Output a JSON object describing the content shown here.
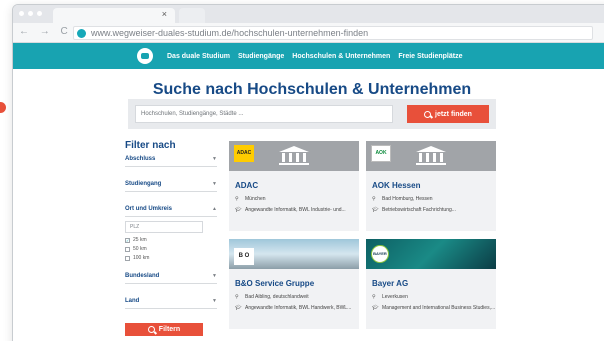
{
  "browser": {
    "url": "www.wegweiser-duales-studium.de/hochschulen-unternehmen-finden",
    "tab_close": "×",
    "nav_buttons": "← → C ⌂"
  },
  "sitenav": {
    "items": [
      "Das duale Studium",
      "Studiengänge",
      "Hochschulen & Unternehmen",
      "Freie Studienplätze"
    ]
  },
  "page": {
    "title": "Suche nach Hochschulen & Unternehmen"
  },
  "search": {
    "placeholder": "Hochschulen, Studiengänge, Städte ...",
    "button": "jetzt finden"
  },
  "filter": {
    "title": "Filter nach",
    "abschluss": "Abschluss",
    "studiengang": "Studiengang",
    "ort": "Ort und Umkreis",
    "plz_placeholder": "PLZ",
    "radius": [
      "25 km",
      "50 km",
      "100 km"
    ],
    "bundesland": "Bundesland",
    "land": "Land",
    "button": "Filtern"
  },
  "cards": [
    {
      "name": "ADAC",
      "logo": "ADAC",
      "location": "München",
      "studies": "Angewandte Informatik, BWL Industrie- und..."
    },
    {
      "name": "AOK Hessen",
      "logo": "AOK",
      "location": "Bad Homburg, Hessen",
      "studies": "Betriebswirtschaft Fachrichtung..."
    },
    {
      "name": "B&O Service Gruppe",
      "logo": "B O",
      "location": "Bad Aibling, deutschlandweit",
      "studies": "Angewandte Informatik, BWL Handwerk, BWL..."
    },
    {
      "name": "Bayer AG",
      "logo": "BAYER",
      "location": "Leverkusen",
      "studies": "Management and International Business Studies,..."
    }
  ],
  "colors": {
    "teal": "#18a3b1",
    "navy": "#174a86",
    "accent": "#e8503a"
  }
}
